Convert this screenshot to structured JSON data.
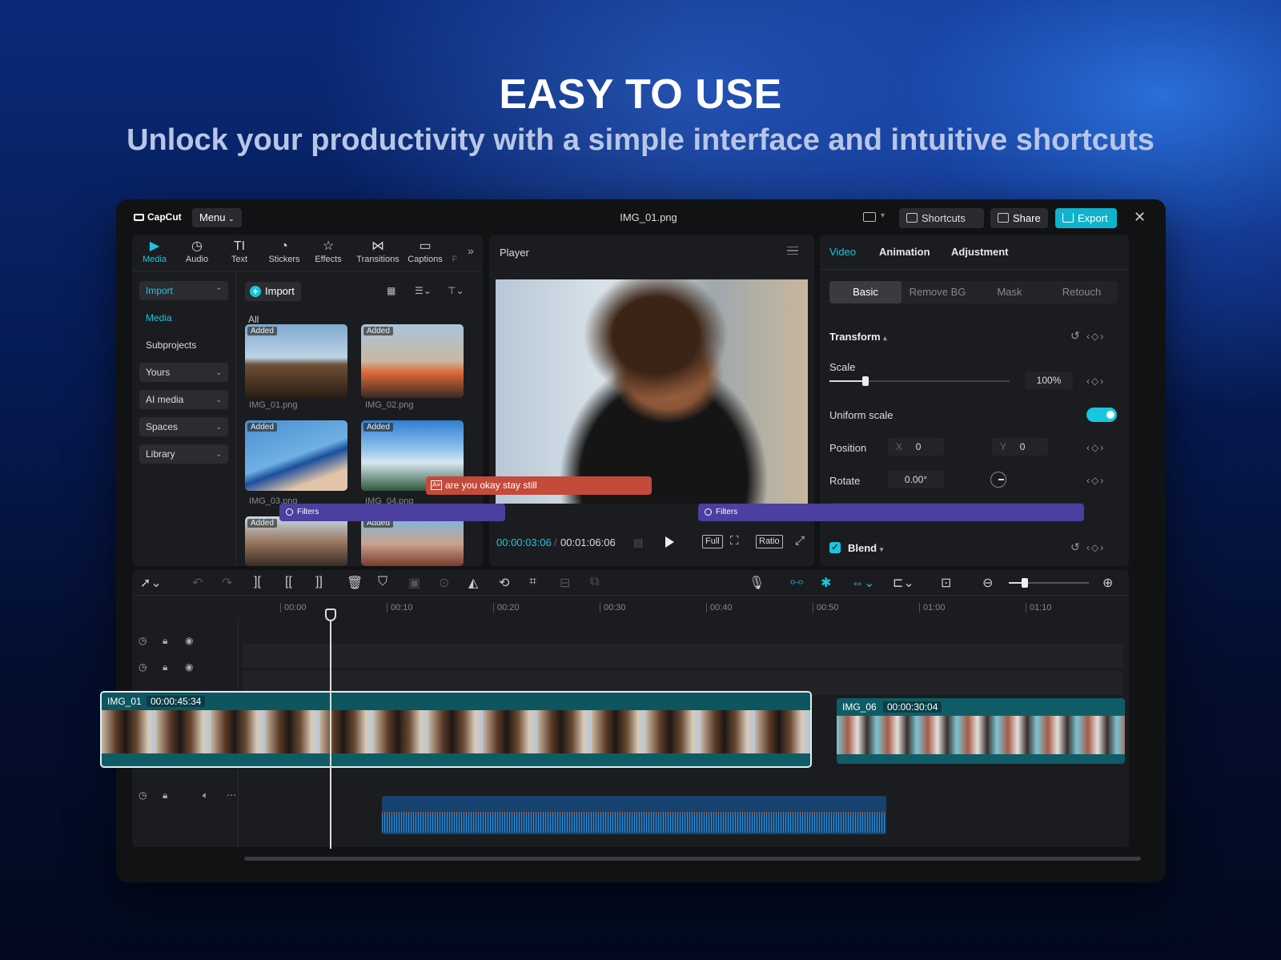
{
  "hero": {
    "headline": "EASY TO USE",
    "subline": "Unlock your productivity with a simple interface and intuitive shortcuts"
  },
  "app": {
    "logo": "CapCut",
    "menu_label": "Menu",
    "document_title": "IMG_01.png",
    "shortcuts_label": "Shortcuts",
    "share_label": "Share",
    "export_label": "Export",
    "accent": "#18c7de"
  },
  "media_panel": {
    "categories": [
      {
        "label": "Media",
        "icon": "media-icon"
      },
      {
        "label": "Audio",
        "icon": "audio-icon"
      },
      {
        "label": "Text",
        "icon": "text-icon"
      },
      {
        "label": "Stickers",
        "icon": "stickers-icon"
      },
      {
        "label": "Effects",
        "icon": "effects-icon"
      },
      {
        "label": "Transitions",
        "icon": "transitions-icon"
      },
      {
        "label": "Captions",
        "icon": "captions-icon"
      },
      {
        "label": "F",
        "icon": ""
      }
    ],
    "sidebar": {
      "import": "Import",
      "media": "Media",
      "subprojects": "Subprojects",
      "yours": "Yours",
      "ai_media": "AI media",
      "spaces": "Spaces",
      "library": "Library"
    },
    "import_button": "Import",
    "filter_label": "All",
    "added_tag": "Added",
    "items": [
      "IMG_01.png",
      "IMG_02.png",
      "IMG_03.png",
      "IMG_04.png",
      "",
      ""
    ]
  },
  "player": {
    "title": "Player",
    "current_time": "00:00:03:06",
    "total_time": "00:01:06:06",
    "full_label": "Full",
    "ratio_label": "Ratio"
  },
  "properties": {
    "tabs": [
      "Video",
      "Animation",
      "Adjustment"
    ],
    "subtabs": [
      "Basic",
      "Remove BG",
      "Mask",
      "Retouch"
    ],
    "transform_label": "Transform",
    "scale_label": "Scale",
    "scale_value": "100%",
    "scale_fraction": 0.2,
    "uniform_scale_label": "Uniform scale",
    "uniform_scale_on": true,
    "position_label": "Position",
    "pos_x_label": "X",
    "pos_x_value": "0",
    "pos_y_label": "Y",
    "pos_y_value": "0",
    "rotate_label": "Rotate",
    "rotate_value": "0.00°",
    "blend_label": "Blend",
    "blend_checked": true
  },
  "timeline": {
    "ruler": [
      "00:00",
      "00:10",
      "00:20",
      "00:30",
      "00:40",
      "00:50",
      "01:00",
      "01:10"
    ],
    "text_clip": "are you okay stay still",
    "filter_label": "Filters",
    "main_clip_name": "IMG_01",
    "main_clip_duration": "00:00:45:34",
    "second_clip_name": "IMG_06",
    "second_clip_duration": "00:00:30:04",
    "text_clip_color": "#c44a3a",
    "filter_color": "#4b3fa0",
    "video_clip_color": "#0f5c66",
    "audio_clip_color": "#15426e"
  }
}
